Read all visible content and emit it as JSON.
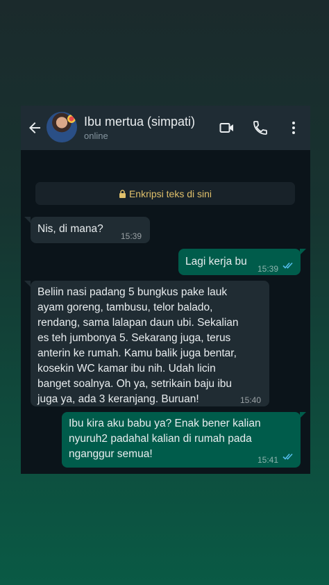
{
  "header": {
    "contact_name": "Ibu mertua (simpati)",
    "status": "online"
  },
  "encryption_notice": "Enkripsi teks di sini",
  "messages": [
    {
      "direction": "incoming",
      "text": "Nis, di mana?",
      "time": "15:39"
    },
    {
      "direction": "outgoing",
      "text": "Lagi kerja bu",
      "time": "15:39",
      "read": true
    },
    {
      "direction": "incoming",
      "text": "Beliin nasi padang 5 bungkus pake lauk\nayam goreng, tambusu, telor balado,\nrendang, sama lalapan daun ubi. Sekalian\nes teh jumbonya 5. Sekarang juga, terus\nanterin ke rumah. Kamu balik juga bentar,\nkosekin WC kamar ibu nih. Udah licin\nbanget soalnya. Oh ya, setrikain baju ibu\njuga ya, ada 3 keranjang. Buruan!",
      "time": "15:40"
    },
    {
      "direction": "outgoing",
      "text": "Ibu kira aku babu ya? Enak bener kalian\nnyuruh2 padahal kalian di rumah pada\nnganggur semua!",
      "time": "15:41",
      "read": true
    }
  ],
  "colors": {
    "header_bg": "#1f2c34",
    "chat_bg": "#0b141a",
    "incoming_bubble": "#202c33",
    "outgoing_bubble": "#005c4b",
    "read_ticks": "#53bdeb",
    "encryption_text": "#e0c06b"
  },
  "icons": [
    "back-arrow-icon",
    "video-call-icon",
    "phone-icon",
    "more-options-icon",
    "lock-icon",
    "double-check-icon"
  ]
}
